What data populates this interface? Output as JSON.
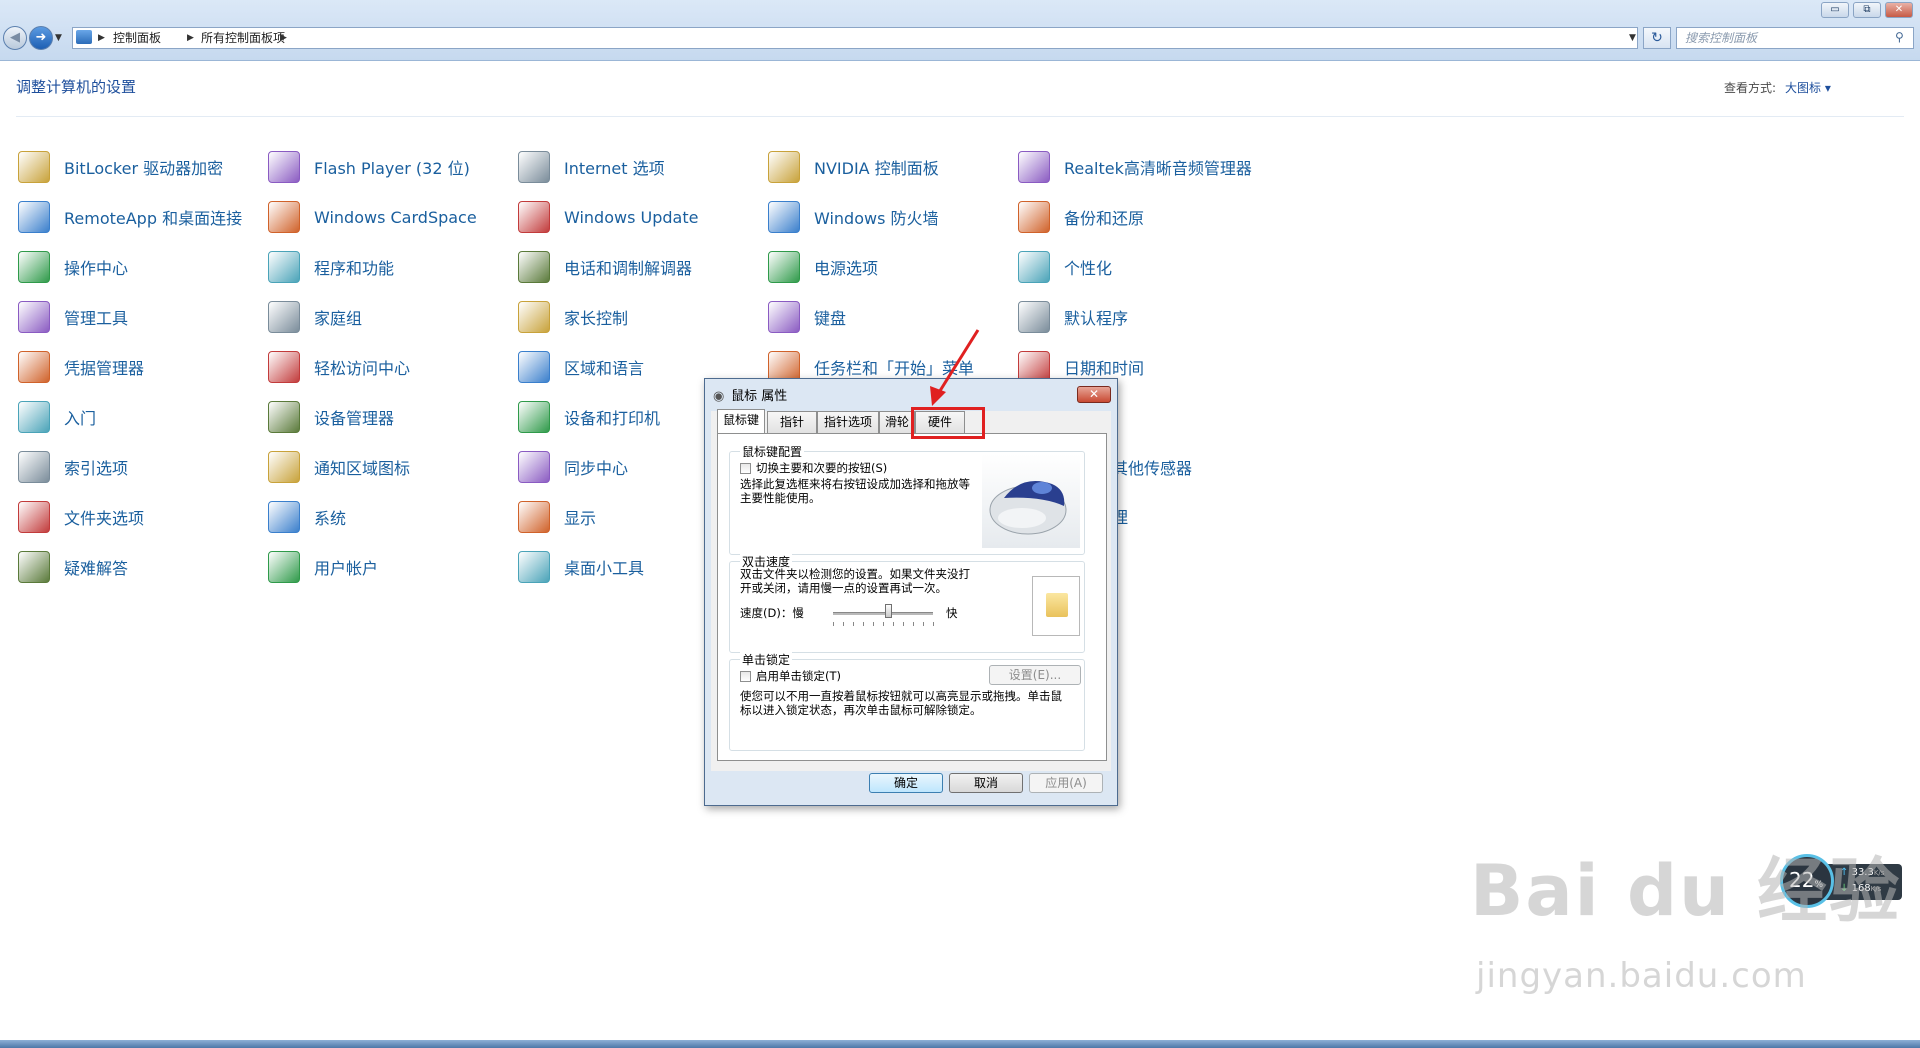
{
  "window": {
    "address_parts": [
      "控制面板",
      "所有控制面板项"
    ],
    "search_placeholder": "搜索控制面板",
    "buttons": {
      "minimize": "▭",
      "maximize": "⧉",
      "close": "✕"
    }
  },
  "header": {
    "title": "调整计算机的设置",
    "view_label": "查看方式:",
    "view_value": "大图标 ▾"
  },
  "columns": [
    [
      "BitLocker 驱动器加密",
      "RemoteApp 和桌面连接",
      "操作中心",
      "管理工具",
      "凭据管理器",
      "入门",
      "索引选项",
      "文件夹选项",
      "疑难解答"
    ],
    [
      "Flash Player (32 位)",
      "Windows CardSpace",
      "程序和功能",
      "家庭组",
      "轻松访问中心",
      "设备管理器",
      "通知区域图标",
      "系统",
      "用户帐户"
    ],
    [
      "Internet 选项",
      "Windows Update",
      "电话和调制解调器",
      "家长控制",
      "区域和语言",
      "设备和打印机",
      "同步中心",
      "显示",
      "桌面小工具"
    ],
    [
      "NVIDIA 控制面板",
      "Windows 防火墙",
      "电源选项",
      "键盘",
      "任务栏和「开始」菜单"
    ],
    [
      "Realtek高清晰音频管理器",
      "备份和还原",
      "个性化",
      "默认程序",
      "日期和时间"
    ]
  ],
  "partial_items": [
    "其他传感器",
    "理"
  ],
  "dialog": {
    "title": "鼠标 属性",
    "close": "✕",
    "tabs": [
      "鼠标键",
      "指针",
      "指针选项",
      "滑轮",
      "硬件"
    ],
    "group1": {
      "title": "鼠标键配置",
      "checkbox": "切换主要和次要的按钮(S)",
      "description": "选择此复选框来将右按钮设成加选择和拖放等主要性能使用。"
    },
    "group2": {
      "title": "双击速度",
      "description": "双击文件夹以检测您的设置。如果文件夹没打开或关闭，请用慢一点的设置再试一次。",
      "speed_label": "速度(D)：慢",
      "fast_label": "快",
      "slider_value": 0.55
    },
    "group3": {
      "title": "单击锁定",
      "checkbox": "启用单击锁定(T)",
      "settings_button": "设置(E)...",
      "description": "使您可以不用一直按着鼠标按钮就可以高亮显示或拖拽。单击鼠标以进入锁定状态，再次单击鼠标可解除锁定。"
    },
    "buttons": {
      "ok": "确定",
      "cancel": "取消",
      "apply": "应用(A)"
    }
  },
  "widget": {
    "percent": "22",
    "percent_unit": "%",
    "up": "33.3",
    "up_unit": "K/s",
    "down": "168",
    "down_unit": "K/s"
  },
  "watermark": {
    "brand": "Bai du 经验",
    "url": "jingyan.baidu.com"
  },
  "colors": {
    "link": "#1a5f9e",
    "title": "#1e4f9c",
    "highlight": "#e02020"
  },
  "icons": [
    [
      "key-shield-icon",
      "remote-desktop-icon",
      "flag-icon",
      "tools-icon",
      "vault-icon",
      "getting-started-icon",
      "magnifier-icon",
      "folder-options-icon",
      "troubleshoot-icon"
    ],
    [
      "flash-icon",
      "cardspace-icon",
      "programs-icon",
      "homegroup-icon",
      "ease-of-access-icon",
      "device-manager-icon",
      "notification-icon",
      "system-icon",
      "users-icon"
    ],
    [
      "internet-globe-icon",
      "windows-update-icon",
      "phone-modem-icon",
      "parental-controls-icon",
      "region-globe-icon",
      "printer-icon",
      "sync-icon",
      "display-icon",
      "gadgets-icon"
    ],
    [
      "nvidia-icon",
      "firewall-icon",
      "power-icon",
      "keyboard-icon",
      "taskbar-icon"
    ],
    [
      "audio-icon",
      "backup-icon",
      "personalize-icon",
      "default-programs-icon",
      "clock-icon"
    ]
  ]
}
